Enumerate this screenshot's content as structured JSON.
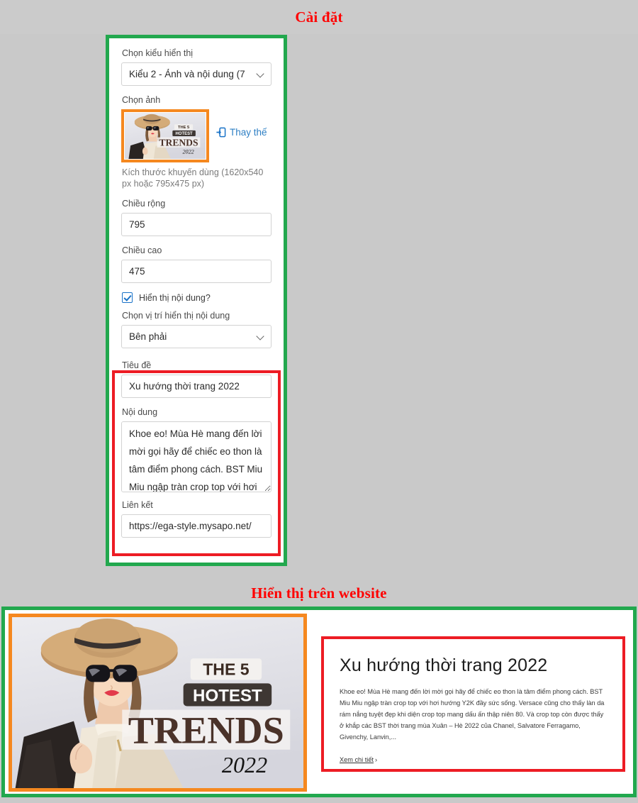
{
  "headings": {
    "settings": "Cài đặt",
    "website_preview": "Hiển thị trên website"
  },
  "settings_panel": {
    "display_style": {
      "label": "Chọn kiểu hiển thị",
      "value": "Kiểu 2 - Ảnh và nội dung (7",
      "icon": "chevron-down-icon"
    },
    "image_picker": {
      "label": "Chọn ảnh",
      "replace_label": "Thay thế",
      "replace_icon": "import-arrow-icon",
      "hint": "Kích thước khuyến dùng (1620x540 px hoặc 795x475 px)"
    },
    "width": {
      "label": "Chiều rộng",
      "value": "795"
    },
    "height": {
      "label": "Chiều cao",
      "value": "475"
    },
    "show_content": {
      "label": "Hiển thị nội dung?",
      "checked": true
    },
    "content_position": {
      "label": "Chọn vị trí hiển thị nội dung",
      "value": "Bên phải",
      "icon": "chevron-down-icon"
    },
    "title": {
      "label": "Tiêu đề",
      "value": "Xu hướng thời trang 2022"
    },
    "content": {
      "label": "Nội dung",
      "value": "Khoe eo! Mùa Hè mang đến lời mời gọi hãy để chiếc eo thon là tâm điểm phong cách. BST Miu Miu ngập tràn crop top với hơi hướng Y2K đầy sức sống."
    },
    "link": {
      "label": "Liên kết",
      "value": "https://ega-style.mysapo.net/"
    }
  },
  "website_preview": {
    "banner_image": {
      "alt": "fashion-model-hat-sunglasses",
      "overlay_line1": "THE 5",
      "overlay_line2": "HOTEST",
      "overlay_line3": "TRENDS",
      "overlay_line4": "2022"
    },
    "title": "Xu hướng thời trang 2022",
    "body": "Khoe eo! Mùa Hè mang đến lời mời gọi hãy để chiếc eo thon là tâm điểm phong cách. BST Miu Miu ngập tràn crop top với hơi hướng Y2K đầy sức sống. Versace cũng cho thấy làn da rám nắng tuyệt đẹp khi diện crop top mang dấu ấn thập niên 80. Và crop top còn được thấy ở khắp các BST thời trang mùa Xuân – Hè 2022 của Chanel, Salvatore Ferragamo, Givenchy, Lanvin,...",
    "link_label": "Xem chi tiết",
    "link_chevron": "chevron-right-icon"
  },
  "colors": {
    "heading_red": "#ff0000",
    "outline_green": "#22a84e",
    "outline_orange": "#f5881f",
    "outline_red": "#ed1c24",
    "accent_blue": "#2e7fc4",
    "page_bg": "#c9c9c9"
  }
}
